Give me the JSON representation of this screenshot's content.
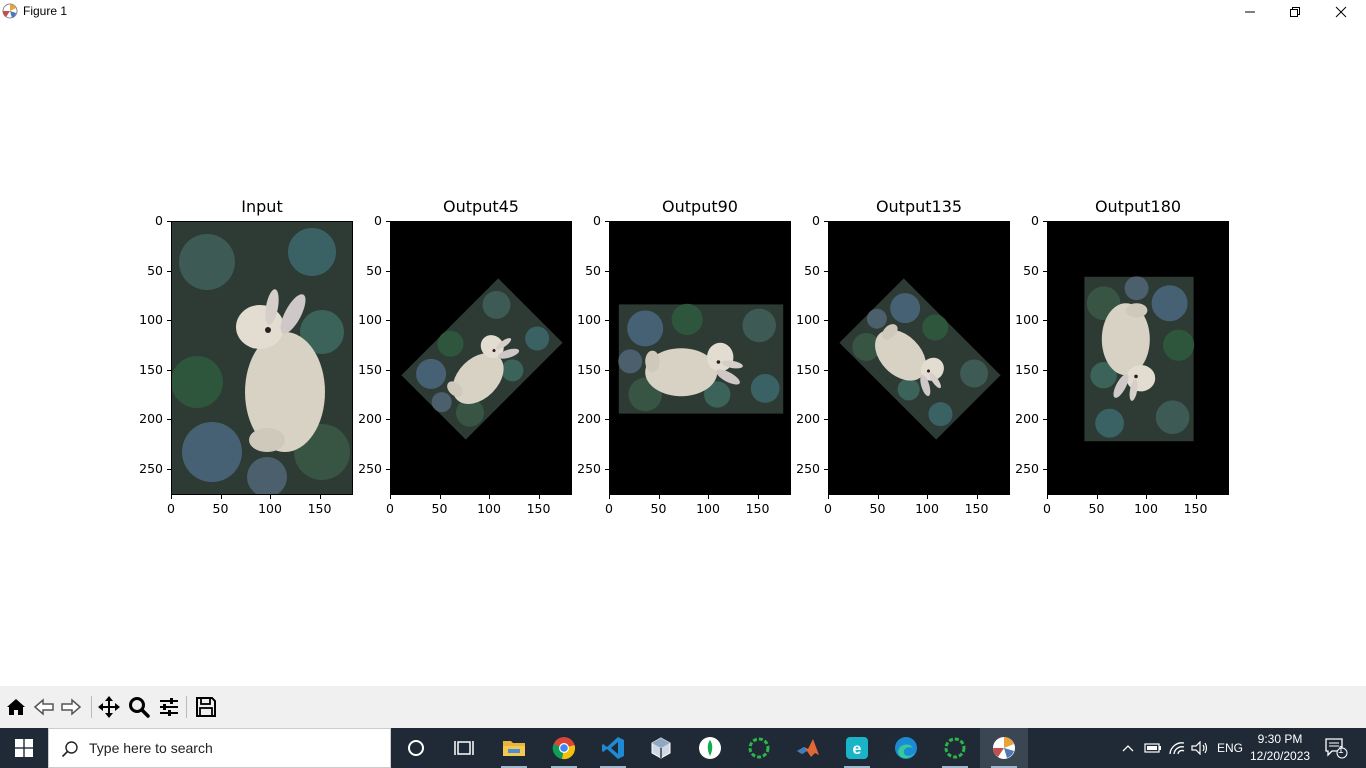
{
  "window": {
    "title": "Figure 1"
  },
  "figure": {
    "panels": [
      {
        "title": "Input",
        "rotation_deg": 0
      },
      {
        "title": "Output45",
        "rotation_deg": 45
      },
      {
        "title": "Output90",
        "rotation_deg": 90
      },
      {
        "title": "Output135",
        "rotation_deg": 135
      },
      {
        "title": "Output180",
        "rotation_deg": 180
      }
    ],
    "y_ticks": [
      "0",
      "50",
      "100",
      "150",
      "200",
      "250"
    ],
    "x_ticks": [
      "0",
      "50",
      "100",
      "150"
    ]
  },
  "toolbar": {
    "buttons": [
      "home-icon",
      "back-arrow-icon",
      "forward-arrow-icon",
      "pan-icon",
      "zoom-icon",
      "configure-subplots-icon",
      "save-icon"
    ]
  },
  "taskbar": {
    "search_placeholder": "Type here to search",
    "tray": {
      "language": "ENG",
      "time": "9:30 PM",
      "date": "12/20/2023",
      "notifications": "1"
    }
  },
  "colors": {
    "taskbar_bg": "#1f2a36",
    "toolbar_bg": "#f0f0f0",
    "image_bg": "#000000"
  }
}
